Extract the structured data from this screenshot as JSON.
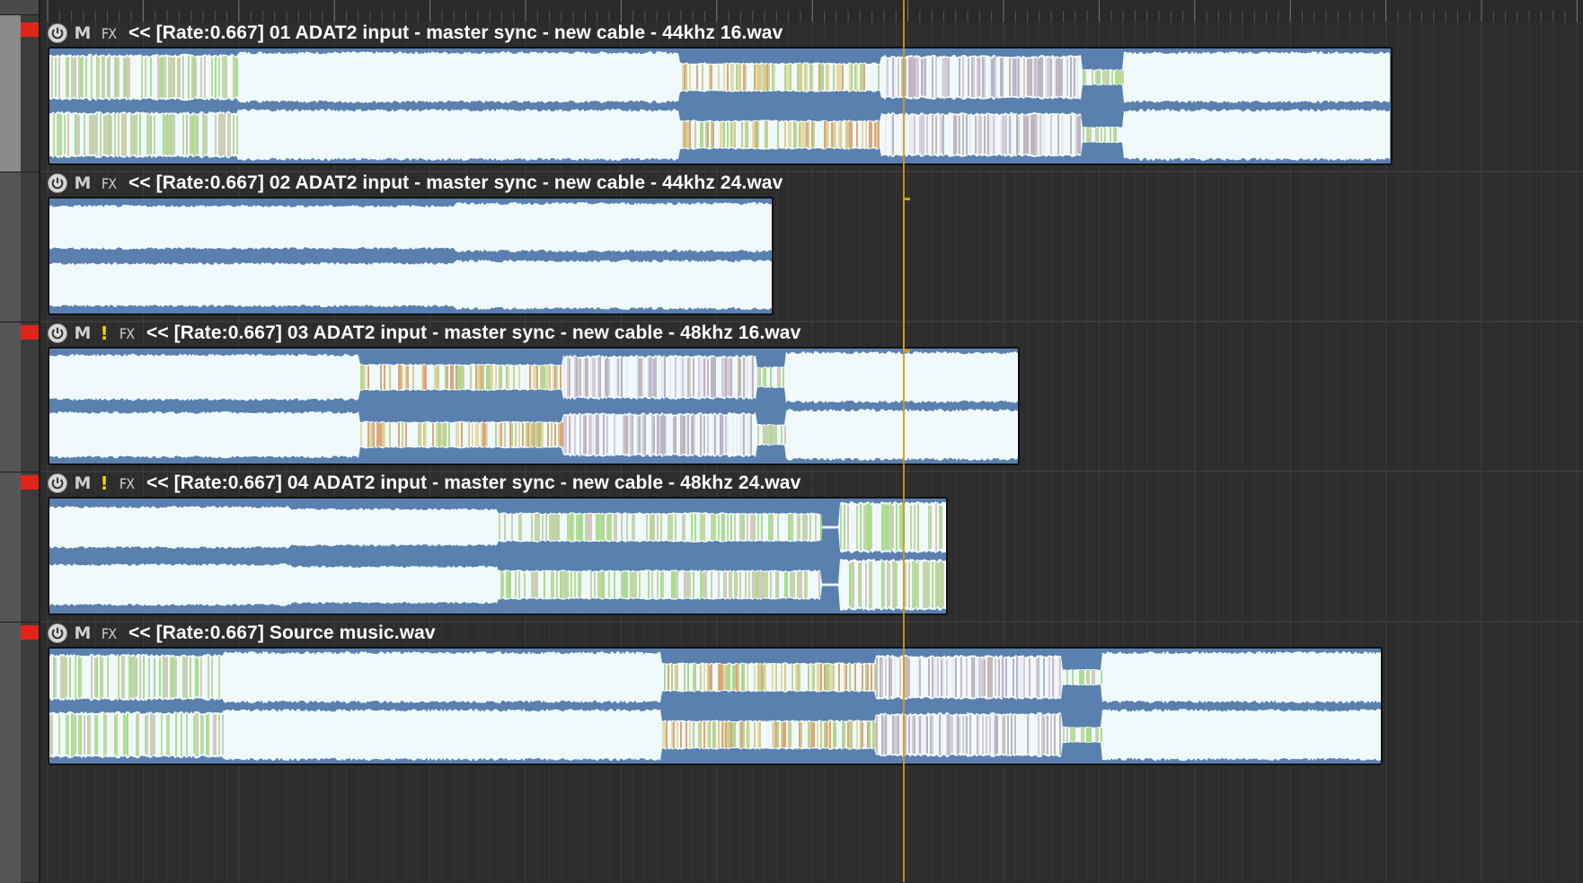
{
  "tracks": [
    {
      "record_armed": true,
      "selected": true,
      "item": {
        "title": "<< [Rate:0.667] 01 ADAT2 input - master sync - new cable - 44khz 16.wav",
        "has_warning": false
      }
    },
    {
      "record_armed": false,
      "selected": false,
      "item": {
        "title": "<< [Rate:0.667] 02 ADAT2 input - master sync - new cable - 44khz 24.wav",
        "has_warning": false
      }
    },
    {
      "record_armed": true,
      "selected": false,
      "item": {
        "title": "<< [Rate:0.667] 03 ADAT2 input - master sync - new cable - 48khz 16.wav",
        "has_warning": true
      }
    },
    {
      "record_armed": true,
      "selected": false,
      "item": {
        "title": "<< [Rate:0.667] 04 ADAT2 input - master sync - new cable - 48khz 24.wav",
        "has_warning": true
      }
    },
    {
      "record_armed": true,
      "selected": false,
      "item": {
        "title": "<< [Rate:0.667] Source music.wav",
        "has_warning": false
      }
    }
  ],
  "item_controls": {
    "mute_label": "M",
    "fx_label": "FX",
    "warning_label": "!"
  },
  "colors": {
    "waveform_fill": "#f0fafc",
    "item_background": "#5a80b0",
    "record_arm": "#e0241a",
    "edit_cursor": "#d29a1a",
    "warning": "#f2d200"
  },
  "icons": {
    "power": "item-power-icon",
    "warning": "warning-icon"
  }
}
